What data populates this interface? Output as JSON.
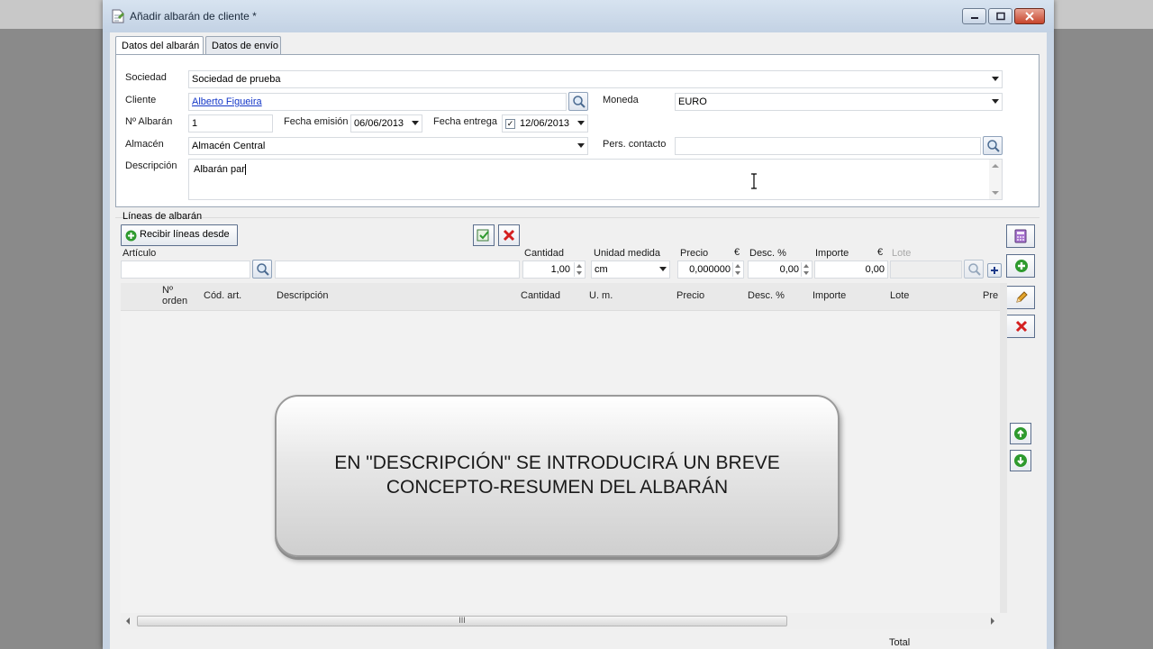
{
  "window": {
    "title": "Añadir albarán de cliente *"
  },
  "tabs": [
    {
      "label": "Datos del albarán",
      "active": true
    },
    {
      "label": "Datos de envío",
      "active": false
    }
  ],
  "header": {
    "sociedad_label": "Sociedad",
    "sociedad_value": "Sociedad de prueba",
    "cliente_label": "Cliente",
    "cliente_value": "Alberto Figueira",
    "moneda_label": "Moneda",
    "moneda_value": "EURO",
    "albaran_label": "Nº Albarán",
    "albaran_value": "1",
    "fecha_emision_label": "Fecha emisión",
    "fecha_emision_value": "06/06/2013",
    "fecha_entrega_label": "Fecha entrega",
    "fecha_entrega_value": "12/06/2013",
    "fecha_entrega_checked": true,
    "almacen_label": "Almacén",
    "almacen_value": "Almacén Central",
    "contacto_label": "Pers. contacto",
    "contacto_value": "",
    "descripcion_label": "Descripción",
    "descripcion_value": "Albarán par"
  },
  "lines": {
    "section_title": "Líneas de albarán",
    "recibir_button": "Recibir líneas desde",
    "articulo_label": "Artículo",
    "cantidad_label": "Cantidad",
    "cantidad_value": "1,00",
    "unidad_label": "Unidad medida",
    "unidad_value": "cm",
    "precio_label": "Precio",
    "precio_currency": "€",
    "precio_value": "0,000000",
    "desc_label": "Desc. %",
    "desc_value": "0,00",
    "importe_label": "Importe",
    "importe_currency": "€",
    "importe_value": "0,00",
    "lote_label": "Lote",
    "lote_value": ""
  },
  "grid": {
    "columns": [
      "Nº orden",
      "Cód. art.",
      "Descripción",
      "Cantidad",
      "U. m.",
      "Precio",
      "Desc. %",
      "Importe",
      "Lote",
      "Pre"
    ],
    "rows": []
  },
  "scrollbar_grip": "III",
  "footer": {
    "total_label": "Total"
  },
  "callout": {
    "line1": "EN \"DESCRIPCIÓN\" SE INTRODUCIRÁ UN BREVE",
    "line2": "CONCEPTO-RESUMEN DEL ALBARÁN"
  },
  "colors": {
    "accent_green": "#2e9a2e",
    "delete_red": "#d42020",
    "link_blue": "#1538c8"
  }
}
